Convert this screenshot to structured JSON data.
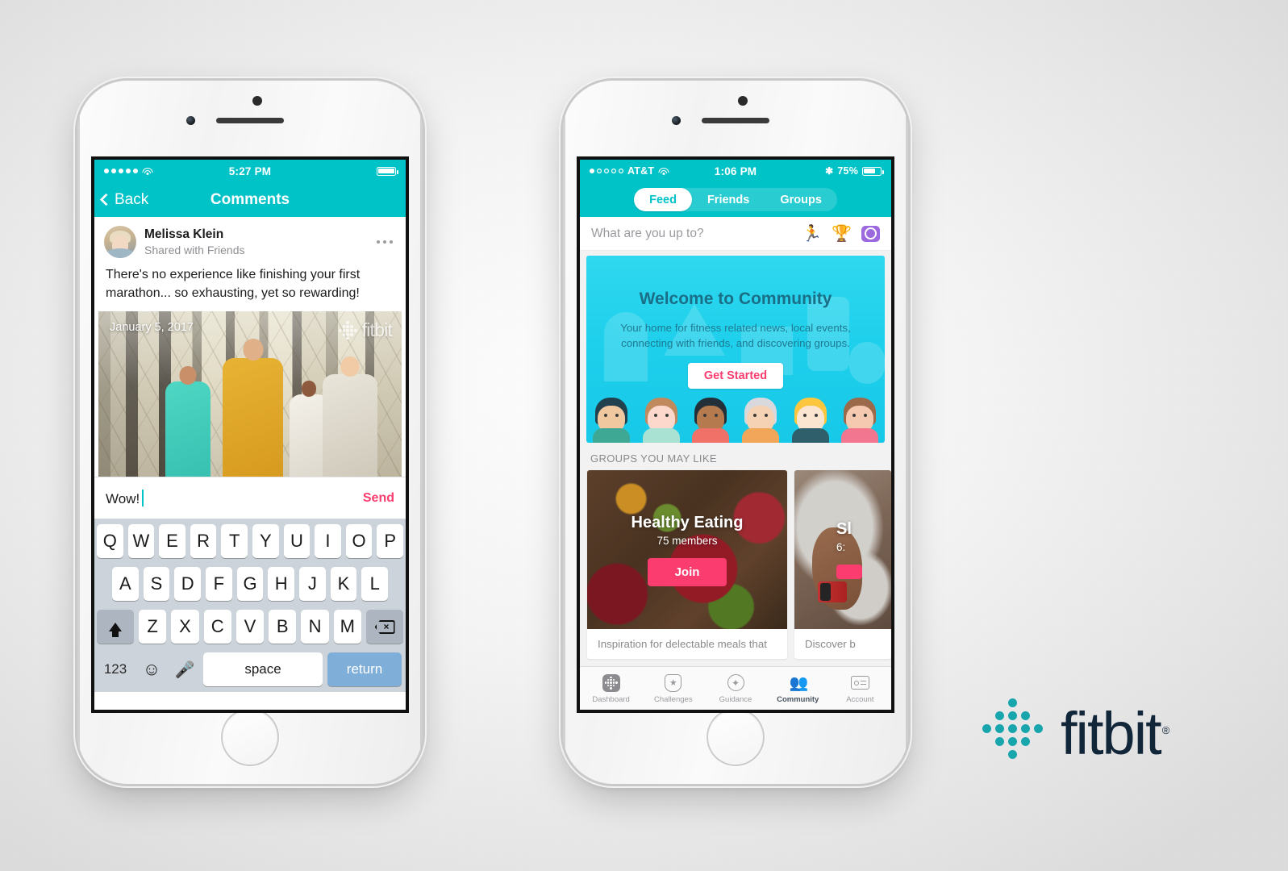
{
  "left_phone": {
    "status_bar": {
      "signal_dots": "•••••",
      "wifi": "wifi-icon",
      "time": "5:27 PM",
      "battery": "battery-full-icon"
    },
    "nav": {
      "back_label": "Back",
      "title": "Comments"
    },
    "post": {
      "author": "Melissa Klein",
      "audience": "Shared with Friends",
      "more_label": "•••",
      "body": "There's no experience like finishing your first marathon... so exhausting, yet so rewarding!",
      "photo_date": "January 5, 2017",
      "photo_watermark": "fitbit"
    },
    "comment_bar": {
      "value": "Wow!",
      "send_label": "Send"
    },
    "keyboard": {
      "row1": [
        "Q",
        "W",
        "E",
        "R",
        "T",
        "Y",
        "U",
        "I",
        "O",
        "P"
      ],
      "row2": [
        "A",
        "S",
        "D",
        "F",
        "G",
        "H",
        "J",
        "K",
        "L"
      ],
      "row3": [
        "Z",
        "X",
        "C",
        "V",
        "B",
        "N",
        "M"
      ],
      "shift_label": "shift-key",
      "delete_label": "delete-key",
      "numbers_label": "123",
      "emoji_label": "☺",
      "mic_label": "mic-key",
      "space_label": "space",
      "return_label": "return"
    }
  },
  "right_phone": {
    "status_bar": {
      "signal_dots": "●○○○○",
      "carrier": "AT&T",
      "wifi": "wifi-icon",
      "time": "1:06 PM",
      "bluetooth": "✱",
      "battery_pct": "75%"
    },
    "segments": [
      {
        "label": "Feed",
        "active": true
      },
      {
        "label": "Friends",
        "active": false
      },
      {
        "label": "Groups",
        "active": false
      }
    ],
    "composer": {
      "placeholder": "What are you up to?",
      "icons": [
        "runner-icon",
        "trophy-icon",
        "camera-icon"
      ]
    },
    "welcome": {
      "title": "Welcome to Community",
      "body": "Your home for fitness related news, local events, connecting with friends, and discovering groups.",
      "cta": "Get Started"
    },
    "groups_section_title": "GROUPS YOU MAY LIKE",
    "groups": [
      {
        "name": "Healthy Eating",
        "members": "75 members",
        "join_label": "Join",
        "description": "Inspiration for delectable meals that"
      },
      {
        "name": "Sl",
        "members": "6:",
        "join_label": "",
        "description": "Discover b"
      }
    ],
    "tabs": [
      {
        "label": "Dashboard",
        "icon": "dashboard-icon",
        "active": false
      },
      {
        "label": "Challenges",
        "icon": "trophy-star-icon",
        "active": false
      },
      {
        "label": "Guidance",
        "icon": "compass-icon",
        "active": false
      },
      {
        "label": "Community",
        "icon": "people-icon",
        "active": true
      },
      {
        "label": "Account",
        "icon": "account-card-icon",
        "active": false
      }
    ]
  },
  "brand": {
    "wordmark": "fitbit",
    "registered": "®"
  },
  "colors": {
    "teal": "#00C3C8",
    "pink": "#FA3C6E",
    "cyan": "#1FD0EC",
    "navy": "#12263A",
    "brand_teal": "#19A5AD"
  }
}
